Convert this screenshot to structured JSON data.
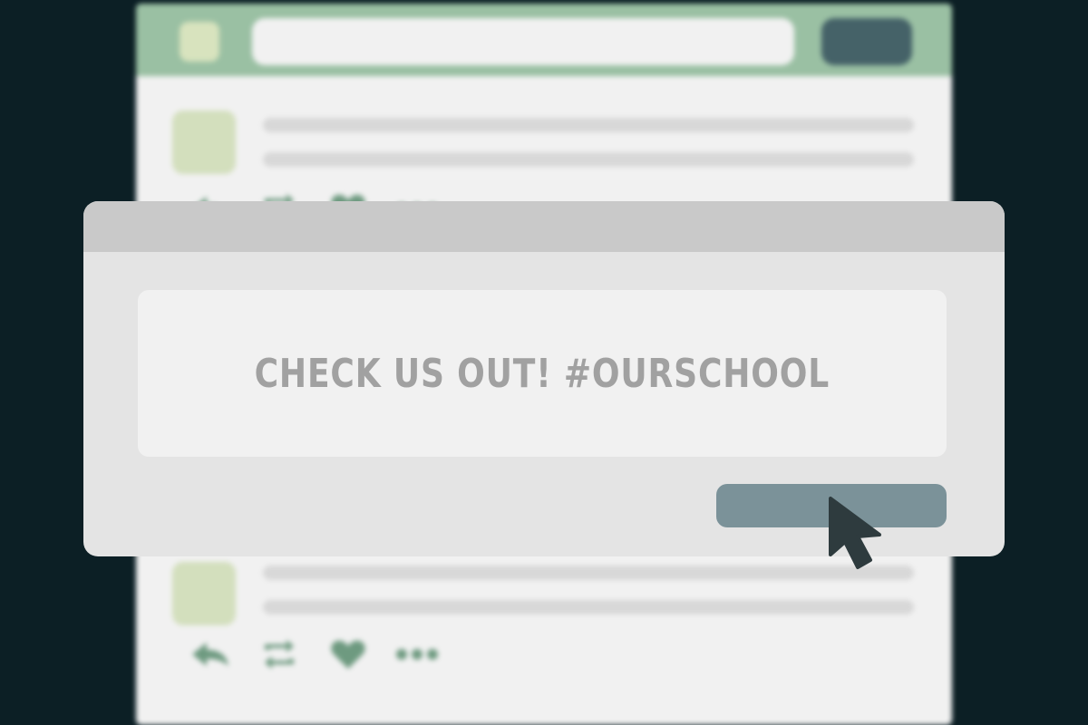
{
  "dialog": {
    "text": "CHECK US OUT! #OURSCHOOL"
  },
  "colors": {
    "background": "#0c1f25",
    "feed_topbar": "#9ac0a3",
    "feed_avatar": "#d3dfbd",
    "feed_icons": "#6e9a80",
    "dialog_button": "#7b9299",
    "cursor": "#2e3b3e"
  },
  "icons": {
    "post_actions": [
      "reply-icon",
      "retweet-icon",
      "heart-icon",
      "more-icon"
    ],
    "pointer": "cursor-arrow-icon"
  }
}
